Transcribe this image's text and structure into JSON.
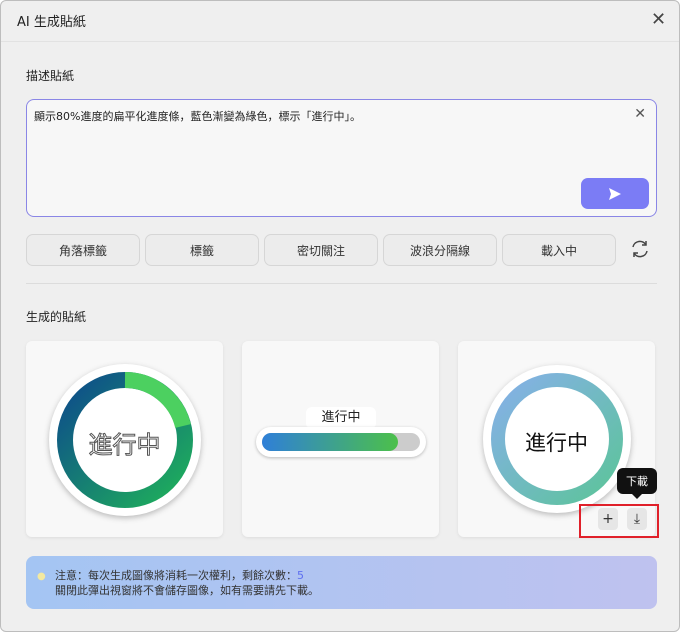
{
  "dialog": {
    "title": "AI 生成貼紙",
    "close_icon": "close-icon"
  },
  "describe": {
    "label": "描述貼紙",
    "value": "顯示80%進度的扁平化進度條，藍色漸變為綠色，標示「進行中」。"
  },
  "chips": [
    "角落標籤",
    "標籤",
    "密切關注",
    "波浪分隔線",
    "載入中"
  ],
  "generated": {
    "label": "生成的貼紙",
    "stickers": [
      {
        "text": "進行中"
      },
      {
        "text": "進行中",
        "progress": 0.8
      },
      {
        "text": "進行中"
      }
    ]
  },
  "tooltip": "下載",
  "notice": {
    "line1": "注意：每次生成圖像將消耗一次權利，剩餘次數：",
    "count": "5",
    "line2": "關閉此彈出視窗將不會儲存圖像，如有需要請先下載。"
  },
  "colors": {
    "accent": "#7b7cf5",
    "highlight": "#e0202a"
  }
}
